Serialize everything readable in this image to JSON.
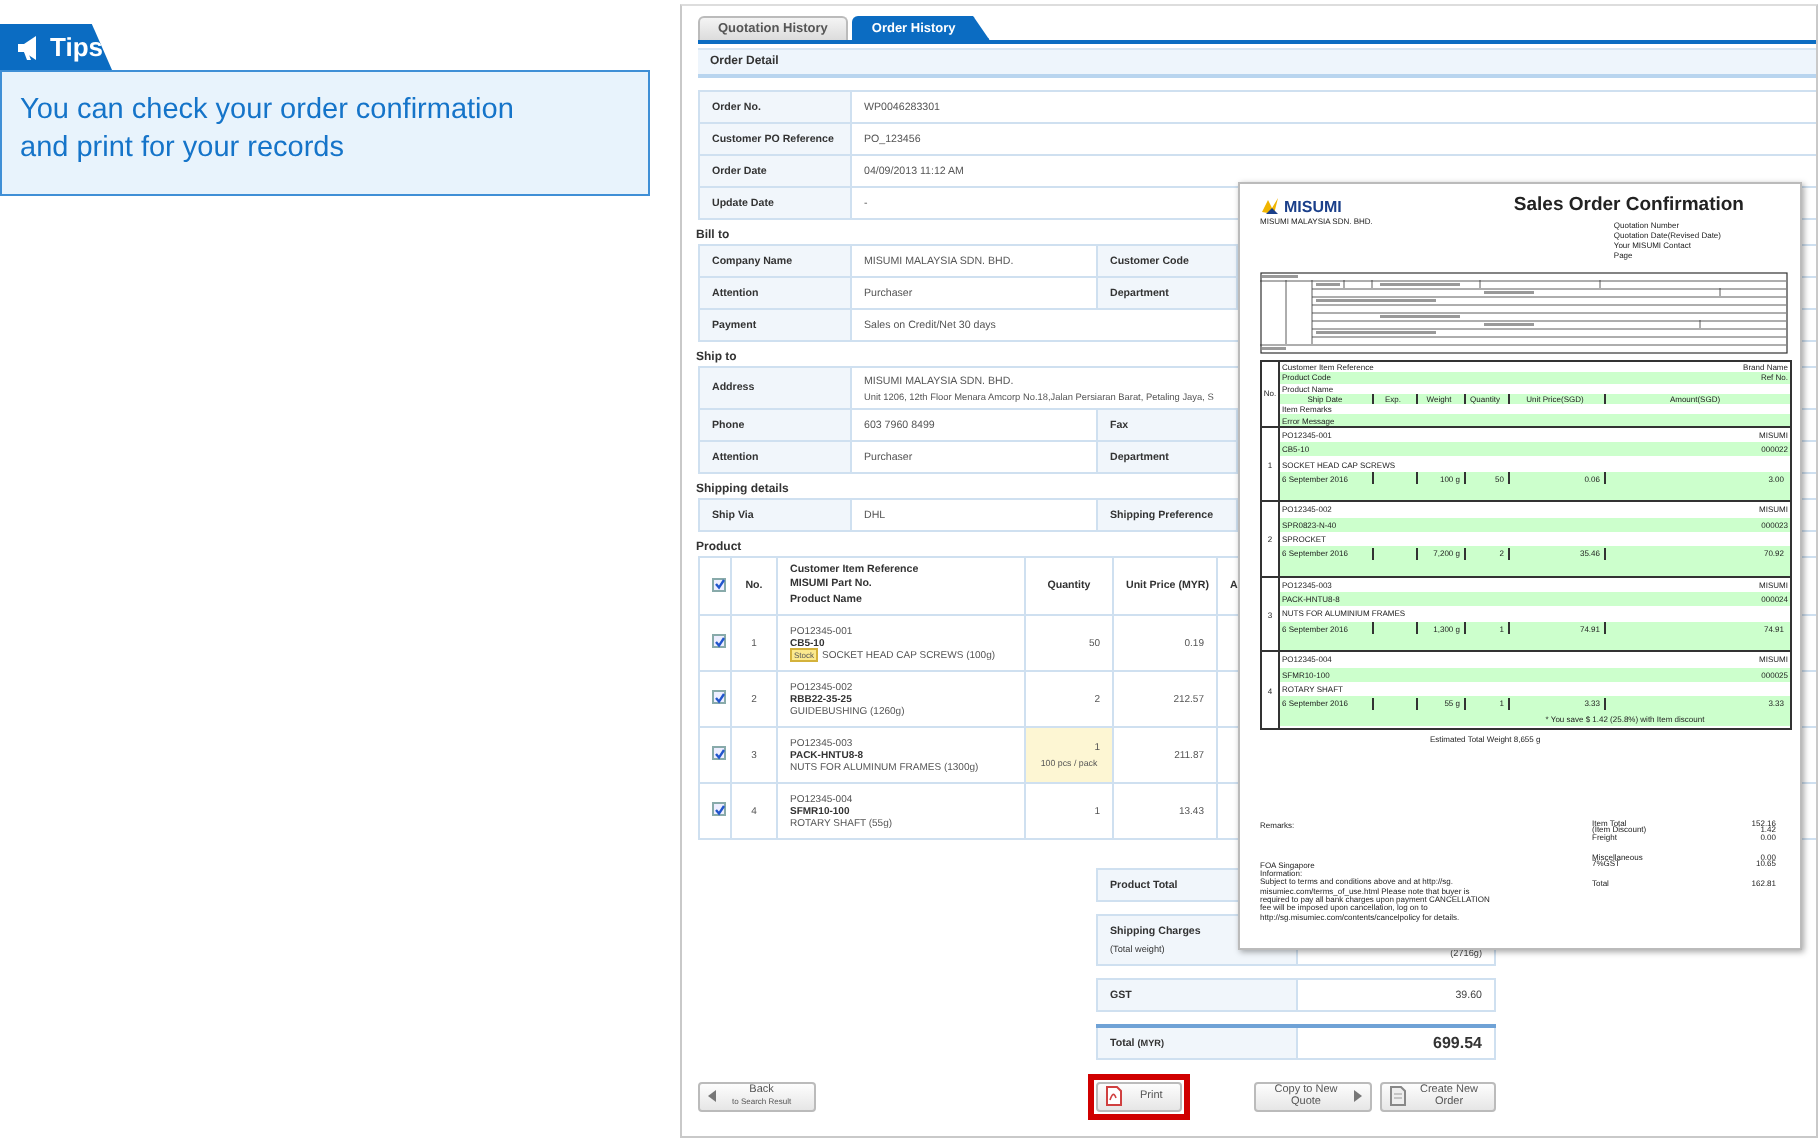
{
  "tips": {
    "title": "Tips",
    "text": "You can check  your order confirmation and print for your records"
  },
  "tabs": [
    {
      "label": "Quotation History",
      "selected": false
    },
    {
      "label": "Order History",
      "selected": true
    }
  ],
  "section_title": "Order Detail",
  "order_info": [
    {
      "label": "Order No.",
      "value": "WP0046283301"
    },
    {
      "label": "Customer PO Reference",
      "value": "PO_123456"
    },
    {
      "label": "Order Date",
      "value": "04/09/2013 11:12 AM"
    },
    {
      "label": "Update Date",
      "value": "-"
    }
  ],
  "bill_to": {
    "title": "Bill to",
    "rows": [
      {
        "label": "Company Name",
        "lines": [
          "MISUMI MALAYSIA SDN. BHD."
        ],
        "label_2": "Customer Code"
      },
      {
        "label": "Attention",
        "lines": [
          "Purchaser"
        ],
        "label_2": "Department"
      },
      {
        "label": "Payment",
        "lines": [
          "Sales on Credit/Net 30 days"
        ]
      }
    ]
  },
  "ship_to": {
    "title": "Ship to",
    "rows": [
      {
        "label": "Address",
        "lines": [
          "MISUMI MALAYSIA SDN. BHD.",
          "Unit 1206, 12th Floor Menara Amcorp No.18,Jalan Persiaran Barat, Petaling Jaya, S"
        ]
      },
      {
        "label": "Phone",
        "lines": [
          "603 7960 8499"
        ],
        "label_2": "Fax"
      },
      {
        "label": "Attention",
        "lines": [
          "Purchaser"
        ],
        "label_2": "Department"
      }
    ]
  },
  "shipping_details": {
    "title": "Shipping details",
    "rows": [
      {
        "label": "Ship Via",
        "lines": [
          "DHL"
        ],
        "label_2": "Shipping Preference"
      }
    ]
  },
  "product": {
    "title": "Product",
    "header_checked": true,
    "columns": {
      "no": "No.",
      "item": [
        "Customer Item Reference",
        "MISUMI Part No.",
        "Product Name"
      ],
      "quantity": "Quantity",
      "unit_price": "Unit Price (MYR)",
      "column_6": "A"
    },
    "rows": [
      {
        "checked": true,
        "no": "1",
        "reference": "PO12345-001",
        "part_no": "CB5-10",
        "badge": "Stock",
        "name": "SOCKET HEAD CAP SCREWS (100g)",
        "quantity": "50",
        "highlighted": false,
        "unit_price": "0.19"
      },
      {
        "checked": true,
        "no": "2",
        "reference": "PO12345-002",
        "part_no": "RBB22-35-25",
        "name": "GUIDEBUSHING (1260g)",
        "quantity": "2",
        "highlighted": false,
        "unit_price": "212.57"
      },
      {
        "checked": true,
        "no": "3",
        "reference": "PO12345-003",
        "part_no": "PACK-HNTU8-8",
        "name": "NUTS FOR ALUMINUM FRAMES (1300g)",
        "quantity": "1",
        "pack_note": "100 pcs / pack",
        "highlighted": true,
        "unit_price": "211.87"
      },
      {
        "checked": true,
        "no": "4",
        "reference": "PO12345-004",
        "part_no": "SFMR10-100",
        "name": "ROTARY SHAFT (55g)",
        "quantity": "1",
        "highlighted": false,
        "unit_price": "13.43"
      }
    ]
  },
  "totals": [
    {
      "kind": "normal",
      "label": "Product Total"
    },
    {
      "kind": "normal",
      "label": "Shipping Charges",
      "sublabel": "(Total weight)",
      "value": "(2716g)"
    },
    {
      "kind": "normal",
      "label": "GST",
      "value": "39.60"
    },
    {
      "kind": "grand",
      "label": "Total",
      "unit": "(MYR)",
      "value": "699.54"
    }
  ],
  "buttons": [
    {
      "kind": "back",
      "label": "Back",
      "sublabel": "to Search Result"
    },
    {
      "kind": "print",
      "label": "Print",
      "highlighted": true
    },
    {
      "kind": "copy",
      "label": "Copy to New Quote"
    },
    {
      "kind": "create",
      "label": "Create New Order"
    }
  ],
  "document": {
    "logo": "MISUMI",
    "title": "Sales Order Confirmation",
    "company": "MISUMI MALAYSIA SDN. BHD.",
    "meta_labels": [
      "Quotation Number",
      "Quotation Date(Revised Date)",
      "Your MISUMI Contact",
      "Page"
    ],
    "no_label": "No.",
    "header": {
      "reference": "Customer Item Reference",
      "brand": "Brand Name",
      "code": "Product Code",
      "ref_no": "Ref No.",
      "name": "Product Name",
      "columns": [
        "Ship Date",
        "Exp.",
        "Weight",
        "Quantity",
        "Unit Price(SGD)",
        "Amount(SGD)"
      ],
      "remarks": "Item Remarks",
      "error": "Error Message"
    },
    "items": [
      {
        "no": "1",
        "reference": "PO12345-001",
        "brand": "MISUMI",
        "code": "CB5-10",
        "ref_no": "000022",
        "name": "SOCKET HEAD CAP SCREWS",
        "date": "6 September 2016",
        "weight": "100 g",
        "quantity": "50",
        "unit_price": "0.06",
        "amount": "3.00"
      },
      {
        "no": "2",
        "reference": "PO12345-002",
        "brand": "MISUMI",
        "code": "SPR0823-N-40",
        "ref_no": "000023",
        "name": "SPROCKET",
        "date": "6 September 2016",
        "weight": "7,200 g",
        "quantity": "2",
        "unit_price": "35.46",
        "amount": "70.92"
      },
      {
        "no": "3",
        "reference": "PO12345-003",
        "brand": "MISUMI",
        "code": "PACK-HNTU8-8",
        "ref_no": "000024",
        "name": "NUTS FOR ALUMINIUM FRAMES",
        "date": "6 September 2016",
        "weight": "1,300 g",
        "quantity": "1",
        "unit_price": "74.91",
        "amount": "74.91"
      },
      {
        "no": "4",
        "reference": "PO12345-004",
        "brand": "MISUMI",
        "code": "SFMR10-100",
        "ref_no": "000025",
        "name": "ROTARY SHAFT",
        "date": "6 September 2016",
        "weight": "55 g",
        "quantity": "1",
        "unit_price": "3.33",
        "amount": "3.33"
      }
    ],
    "discount_note": "* You save $ 1.42 (25.8%) with Item discount",
    "weight_note": "Estimated Total Weight 8,655 g",
    "remarks_label": "Remarks:",
    "summary": [
      {
        "label": "Item Total",
        "value": "152.16"
      },
      {
        "label": "(Item Discount)",
        "value": "1.42"
      },
      {
        "label": "Freight",
        "value": "0.00"
      },
      {
        "label": "Miscellaneous",
        "value": "0.00"
      },
      {
        "label": "7%GST",
        "value": "10.65"
      },
      {
        "label": "Total",
        "value": "162.81"
      }
    ],
    "footer": [
      "FOA Singapore",
      "Information:",
      "Subject to terms and conditions above and at http://sg.",
      "misumiec.com/terms_of_use.html Please note that buyer is",
      "required to pay all bank charges upon payment CANCELLATION",
      "fee will be imposed upon cancellation, log on to",
      "http://sg.misumiec.com/contents/cancelpolicy for details."
    ]
  }
}
